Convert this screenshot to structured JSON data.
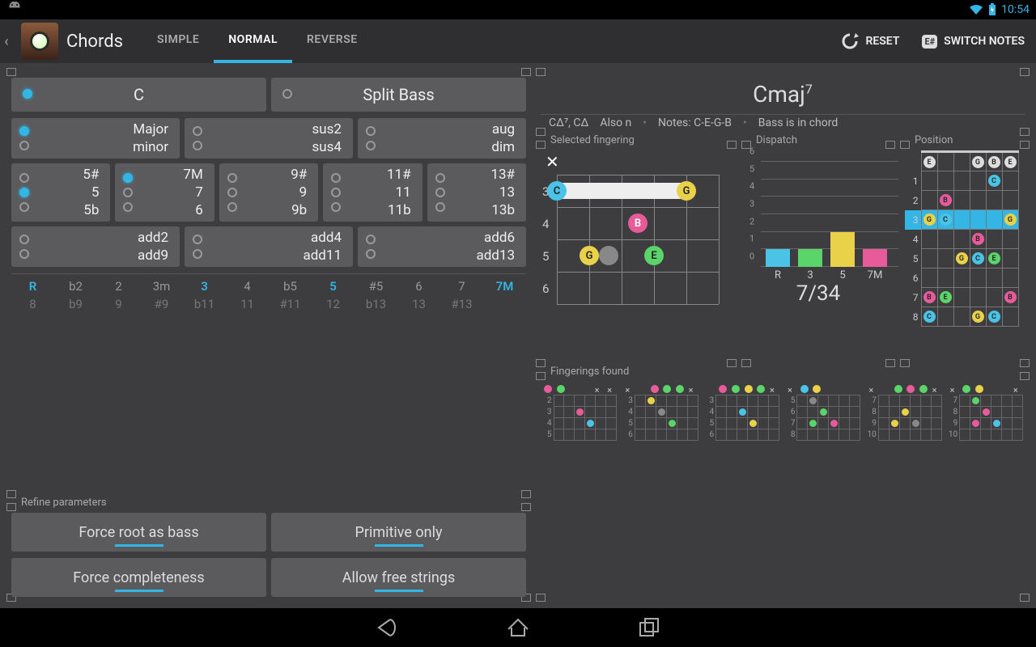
{
  "status": {
    "time": "10:54"
  },
  "app": {
    "title": "Chords",
    "tabs": [
      "SIMPLE",
      "NORMAL",
      "REVERSE"
    ],
    "active_tab": 1,
    "actions": {
      "reset": "RESET",
      "switch": "SWITCH NOTES",
      "switch_icon": "E#"
    }
  },
  "root": {
    "note": "C",
    "split_bass": "Split Bass"
  },
  "quality": {
    "col1": [
      "Major",
      "minor"
    ],
    "col2": [
      "sus2",
      "sus4"
    ],
    "col3": [
      "aug",
      "dim"
    ]
  },
  "ext": {
    "c1": [
      "5#",
      "5",
      "5b"
    ],
    "c2": [
      "7M",
      "7",
      "6"
    ],
    "c3": [
      "9#",
      "9",
      "9b"
    ],
    "c4": [
      "11#",
      "11",
      "11b"
    ],
    "c5": [
      "13#",
      "13",
      "13b"
    ]
  },
  "adds": {
    "a1": [
      "add2",
      "add9"
    ],
    "a2": [
      "add4",
      "add11"
    ],
    "a3": [
      "add6",
      "add13"
    ]
  },
  "degrees": {
    "top": [
      "R",
      "b2",
      "2",
      "3m",
      "3",
      "4",
      "b5",
      "5",
      "#5",
      "6",
      "7",
      "7M"
    ],
    "on": [
      true,
      false,
      false,
      false,
      true,
      false,
      false,
      true,
      false,
      false,
      false,
      true
    ],
    "bot": [
      "8",
      "b9",
      "9",
      "#9",
      "b11",
      "11",
      "#11",
      "12",
      "b13",
      "13",
      "#13",
      ""
    ]
  },
  "refine": {
    "legend": "Refine parameters",
    "b1": "Force root as bass",
    "b2": "Primitive only",
    "b3": "Force completeness",
    "b4": "Allow free strings"
  },
  "result": {
    "name": "Cmaj",
    "sup": "7",
    "alt": "CΔ⁷, CΔ",
    "also": "Also n",
    "notes": "Notes: C-E-G-B",
    "bass": "Bass is in chord"
  },
  "panels": {
    "sel": "Selected fingering",
    "disp": "Dispatch",
    "pos": "Position",
    "found": "Fingerings found"
  },
  "selected": {
    "start_fret": 3,
    "frets": [
      3,
      4,
      5,
      6
    ]
  },
  "dispatch_counter": "7/34",
  "chart_data": {
    "type": "bar",
    "categories": [
      "R",
      "3",
      "5",
      "7M"
    ],
    "values": [
      1,
      1,
      2,
      1
    ],
    "colors": [
      "#4bc3e6",
      "#5bd46a",
      "#e9d24a",
      "#e85b9a"
    ],
    "ylim": [
      0,
      6
    ],
    "yticks": [
      0,
      1,
      2,
      3,
      4,
      5,
      6
    ]
  },
  "position": {
    "highlight_fret": 3,
    "frets": [
      1,
      2,
      3,
      4,
      5,
      6,
      7,
      8
    ]
  },
  "found": {
    "starts": [
      2,
      3,
      3,
      5,
      7,
      7
    ]
  }
}
